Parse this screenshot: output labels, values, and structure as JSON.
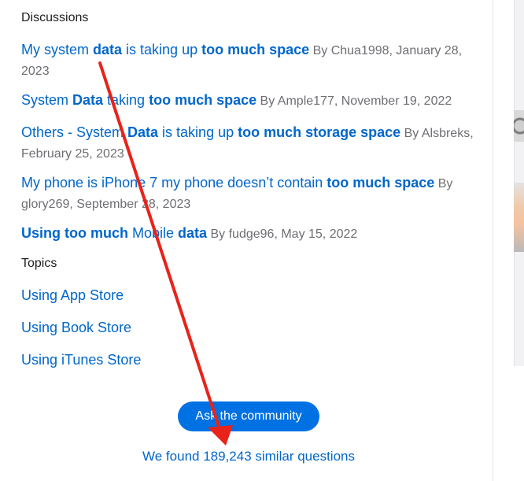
{
  "discussions": {
    "title": "Discussions",
    "items": [
      {
        "parts": [
          {
            "t": "My system ",
            "b": false
          },
          {
            "t": "data",
            "b": true
          },
          {
            "t": " is taking up ",
            "b": false
          },
          {
            "t": "too much space",
            "b": true
          }
        ],
        "meta": " By Chua1998, January 28, 2023"
      },
      {
        "parts": [
          {
            "t": "System ",
            "b": false
          },
          {
            "t": "Data",
            "b": true
          },
          {
            "t": " taking ",
            "b": false
          },
          {
            "t": "too much space",
            "b": true
          }
        ],
        "meta": " By Ample177, November 19, 2022"
      },
      {
        "parts": [
          {
            "t": "Others - System ",
            "b": false
          },
          {
            "t": "Data",
            "b": true
          },
          {
            "t": " is taking up ",
            "b": false
          },
          {
            "t": "too much storage space",
            "b": true
          }
        ],
        "meta": " By Alsbreks, February 25, 2023"
      },
      {
        "parts": [
          {
            "t": "My phone is iPhone 7 my phone doesn’t contain ",
            "b": false
          },
          {
            "t": "too much space",
            "b": true
          }
        ],
        "meta": " By glory269, September 28, 2023"
      },
      {
        "parts": [
          {
            "t": "Using too much",
            "b": true
          },
          {
            "t": " Mobile ",
            "b": false
          },
          {
            "t": "data",
            "b": true
          }
        ],
        "meta": " By fudge96, May 15, 2022"
      }
    ]
  },
  "topics": {
    "title": "Topics",
    "items": [
      "Using App Store",
      "Using Book Store",
      "Using iTunes Store"
    ]
  },
  "cta": {
    "ask_label": "Ask the community",
    "found_text": "We found 189,243 similar questions"
  },
  "colors": {
    "link": "#0066cc",
    "button": "#0071e3",
    "arrow": "#e8231a"
  }
}
